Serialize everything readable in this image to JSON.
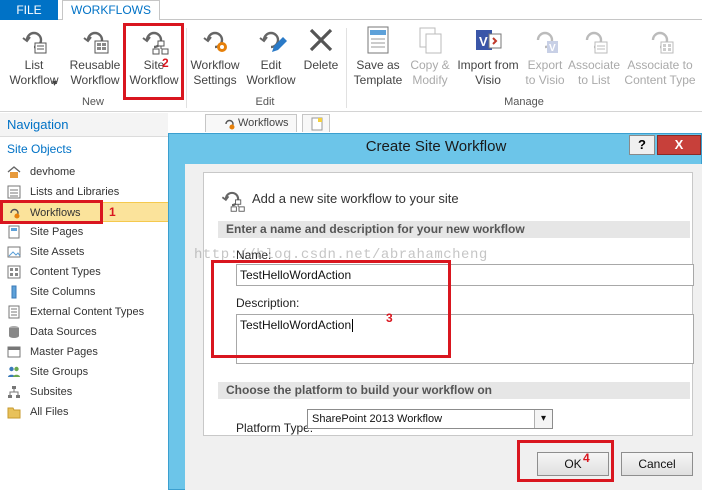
{
  "ribbon": {
    "tabs": [
      {
        "label": "FILE"
      },
      {
        "label": "WORKFLOWS"
      }
    ],
    "buttons": {
      "list_workflow": "List\nWorkflow",
      "reusable_workflow": "Reusable\nWorkflow",
      "site_workflow": "Site\nWorkflow",
      "workflow_settings": "Workflow\nSettings",
      "edit_workflow": "Edit\nWorkflow",
      "delete": "Delete",
      "save_as_template": "Save as\nTemplate",
      "copy_modify": "Copy &\nModify",
      "import_from_visio": "Import from\nVisio",
      "export_to_visio": "Export\nto Visio",
      "associate_to_list": "Associate\nto List",
      "associate_to_content_type": "Associate to\nContent Type"
    },
    "dropdown_arrow": "▾",
    "groups": {
      "new": "New",
      "edit": "Edit",
      "manage": "Manage"
    }
  },
  "navigation": {
    "header": "Navigation",
    "section": "Site Objects",
    "items": [
      {
        "label": "devhome",
        "icon": "home-icon"
      },
      {
        "label": "Lists and Libraries",
        "icon": "list-icon"
      },
      {
        "label": "Workflows",
        "icon": "workflow-icon"
      },
      {
        "label": "Site Pages",
        "icon": "page-icon"
      },
      {
        "label": "Site Assets",
        "icon": "assets-icon"
      },
      {
        "label": "Content Types",
        "icon": "content-types-icon"
      },
      {
        "label": "Site Columns",
        "icon": "columns-icon"
      },
      {
        "label": "External Content Types",
        "icon": "external-icon"
      },
      {
        "label": "Data Sources",
        "icon": "database-icon"
      },
      {
        "label": "Master Pages",
        "icon": "master-pages-icon"
      },
      {
        "label": "Site Groups",
        "icon": "groups-icon"
      },
      {
        "label": "Subsites",
        "icon": "subsites-icon"
      },
      {
        "label": "All Files",
        "icon": "folder-icon"
      }
    ]
  },
  "doc_tab": {
    "label": "Workflows"
  },
  "annotations": {
    "n1": "1",
    "n2": "2",
    "n3": "3",
    "n4": "4"
  },
  "dialog": {
    "title": "Create Site Workflow",
    "help": "?",
    "close": "X",
    "header": "Add a new site workflow to your site",
    "section_name": "Enter a name and description for your new workflow",
    "name_label": "Name:",
    "name_value": "TestHelloWordAction",
    "description_label": "Description:",
    "description_value": "TestHelloWordAction",
    "section_platform": "Choose the platform to build your workflow on",
    "platform_label": "Platform Type:",
    "platform_value": "SharePoint 2013 Workflow",
    "ok": "OK",
    "cancel": "Cancel",
    "watermark": "http://blog.csdn.net/abrahamcheng"
  },
  "colors": {
    "accent": "#0072c6",
    "dialog_frame": "#6cc5e9",
    "annotation_red": "#d9161f",
    "selected_nav": "#fbe39b"
  }
}
